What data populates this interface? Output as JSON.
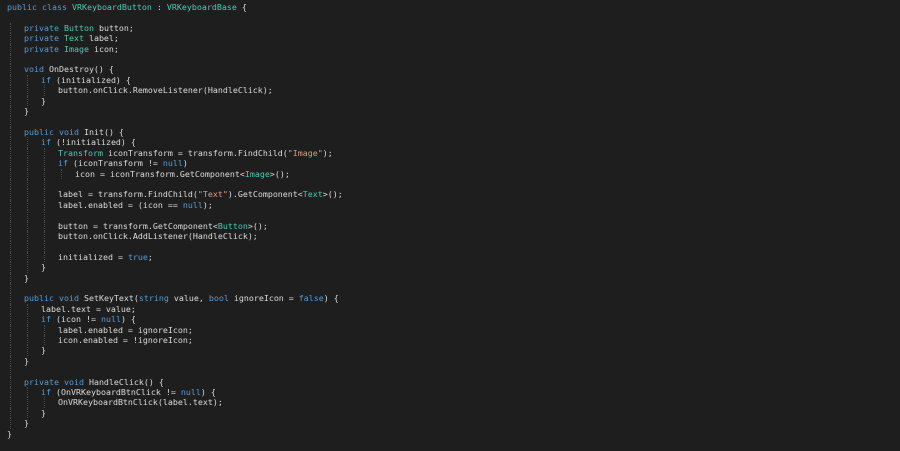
{
  "theme": {
    "background": "#1e1e1e",
    "keyword": "#569cd6",
    "type": "#4ec9b0",
    "string": "#d69d85",
    "text": "#dcdcdc",
    "guide": "#4a4a4a"
  },
  "code_lines": [
    {
      "indent": 0,
      "tokens": [
        [
          "kw",
          "public"
        ],
        [
          "t",
          " "
        ],
        [
          "kw",
          "class"
        ],
        [
          "t",
          " "
        ],
        [
          "type",
          "VRKeyboardButton"
        ],
        [
          "t",
          " : "
        ],
        [
          "type",
          "VRKeyboardBase"
        ],
        [
          "t",
          " {"
        ]
      ]
    },
    {
      "indent": 0,
      "tokens": []
    },
    {
      "indent": 1,
      "tokens": [
        [
          "kw",
          "private"
        ],
        [
          "t",
          " "
        ],
        [
          "type",
          "Button"
        ],
        [
          "t",
          " button;"
        ]
      ]
    },
    {
      "indent": 1,
      "tokens": [
        [
          "kw",
          "private"
        ],
        [
          "t",
          " "
        ],
        [
          "type",
          "Text"
        ],
        [
          "t",
          " label;"
        ]
      ]
    },
    {
      "indent": 1,
      "tokens": [
        [
          "kw",
          "private"
        ],
        [
          "t",
          " "
        ],
        [
          "type",
          "Image"
        ],
        [
          "t",
          " icon;"
        ]
      ]
    },
    {
      "indent": 0,
      "tokens": []
    },
    {
      "indent": 1,
      "tokens": [
        [
          "kw",
          "void"
        ],
        [
          "t",
          " OnDestroy() {"
        ]
      ]
    },
    {
      "indent": 2,
      "tokens": [
        [
          "kw",
          "if"
        ],
        [
          "t",
          " (initialized) {"
        ]
      ]
    },
    {
      "indent": 3,
      "tokens": [
        [
          "t",
          "button.onClick.RemoveListener(HandleClick);"
        ]
      ]
    },
    {
      "indent": 2,
      "tokens": [
        [
          "t",
          "}"
        ]
      ]
    },
    {
      "indent": 1,
      "tokens": [
        [
          "t",
          "}"
        ]
      ]
    },
    {
      "indent": 0,
      "tokens": []
    },
    {
      "indent": 1,
      "tokens": [
        [
          "kw",
          "public"
        ],
        [
          "t",
          " "
        ],
        [
          "kw",
          "void"
        ],
        [
          "t",
          " Init() {"
        ]
      ]
    },
    {
      "indent": 2,
      "tokens": [
        [
          "kw",
          "if"
        ],
        [
          "t",
          " (!initialized) {"
        ]
      ]
    },
    {
      "indent": 3,
      "tokens": [
        [
          "type",
          "Transform"
        ],
        [
          "t",
          " iconTransform = transform.FindChild("
        ],
        [
          "str",
          "\"Image\""
        ],
        [
          "t",
          ");"
        ]
      ]
    },
    {
      "indent": 3,
      "tokens": [
        [
          "kw",
          "if"
        ],
        [
          "t",
          " (iconTransform != "
        ],
        [
          "kw",
          "null"
        ],
        [
          "t",
          ")"
        ]
      ]
    },
    {
      "indent": 4,
      "tokens": [
        [
          "t",
          "icon = iconTransform.GetComponent<"
        ],
        [
          "type",
          "Image"
        ],
        [
          "t",
          ">();"
        ]
      ]
    },
    {
      "indent": 0,
      "tokens": []
    },
    {
      "indent": 3,
      "tokens": [
        [
          "t",
          "label = transform.FindChild("
        ],
        [
          "str",
          "\"Text\""
        ],
        [
          "t",
          ").GetComponent<"
        ],
        [
          "type",
          "Text"
        ],
        [
          "t",
          ">();"
        ]
      ]
    },
    {
      "indent": 3,
      "tokens": [
        [
          "t",
          "label.enabled = (icon == "
        ],
        [
          "kw",
          "null"
        ],
        [
          "t",
          ");"
        ]
      ]
    },
    {
      "indent": 0,
      "tokens": []
    },
    {
      "indent": 3,
      "tokens": [
        [
          "t",
          "button = transform.GetComponent<"
        ],
        [
          "type",
          "Button"
        ],
        [
          "t",
          ">();"
        ]
      ]
    },
    {
      "indent": 3,
      "tokens": [
        [
          "t",
          "button.onClick.AddListener(HandleClick);"
        ]
      ]
    },
    {
      "indent": 0,
      "tokens": []
    },
    {
      "indent": 3,
      "tokens": [
        [
          "t",
          "initialized = "
        ],
        [
          "kw",
          "true"
        ],
        [
          "t",
          ";"
        ]
      ]
    },
    {
      "indent": 2,
      "tokens": [
        [
          "t",
          "}"
        ]
      ]
    },
    {
      "indent": 1,
      "tokens": [
        [
          "t",
          "}"
        ]
      ]
    },
    {
      "indent": 0,
      "tokens": []
    },
    {
      "indent": 1,
      "tokens": [
        [
          "kw",
          "public"
        ],
        [
          "t",
          " "
        ],
        [
          "kw",
          "void"
        ],
        [
          "t",
          " SetKeyText("
        ],
        [
          "kw",
          "string"
        ],
        [
          "t",
          " value, "
        ],
        [
          "kw",
          "bool"
        ],
        [
          "t",
          " ignoreIcon = "
        ],
        [
          "kw",
          "false"
        ],
        [
          "t",
          ") {"
        ]
      ]
    },
    {
      "indent": 2,
      "tokens": [
        [
          "t",
          "label.text = value;"
        ]
      ]
    },
    {
      "indent": 2,
      "tokens": [
        [
          "kw",
          "if"
        ],
        [
          "t",
          " (icon != "
        ],
        [
          "kw",
          "null"
        ],
        [
          "t",
          ") {"
        ]
      ]
    },
    {
      "indent": 3,
      "tokens": [
        [
          "t",
          "label.enabled = ignoreIcon;"
        ]
      ]
    },
    {
      "indent": 3,
      "tokens": [
        [
          "t",
          "icon.enabled = !ignoreIcon;"
        ]
      ]
    },
    {
      "indent": 2,
      "tokens": [
        [
          "t",
          "}"
        ]
      ]
    },
    {
      "indent": 1,
      "tokens": [
        [
          "t",
          "}"
        ]
      ]
    },
    {
      "indent": 0,
      "tokens": []
    },
    {
      "indent": 1,
      "tokens": [
        [
          "kw",
          "private"
        ],
        [
          "t",
          " "
        ],
        [
          "kw",
          "void"
        ],
        [
          "t",
          " HandleClick() {"
        ]
      ]
    },
    {
      "indent": 2,
      "tokens": [
        [
          "kw",
          "if"
        ],
        [
          "t",
          " (OnVRKeyboardBtnClick != "
        ],
        [
          "kw",
          "null"
        ],
        [
          "t",
          ") {"
        ]
      ]
    },
    {
      "indent": 3,
      "tokens": [
        [
          "t",
          "OnVRKeyboardBtnClick(label.text);"
        ]
      ]
    },
    {
      "indent": 2,
      "tokens": [
        [
          "t",
          "}"
        ]
      ]
    },
    {
      "indent": 1,
      "tokens": [
        [
          "t",
          "}"
        ]
      ]
    },
    {
      "indent": 0,
      "tokens": [
        [
          "t",
          "}"
        ]
      ]
    }
  ]
}
